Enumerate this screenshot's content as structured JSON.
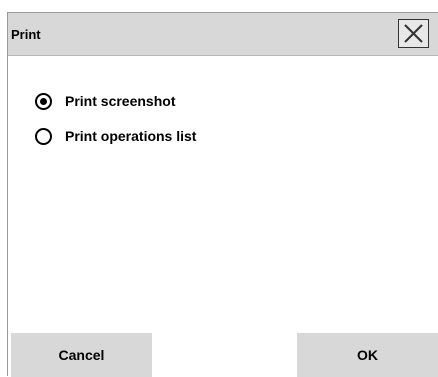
{
  "dialog": {
    "title": "Print",
    "close_icon": "close-x-icon"
  },
  "options": [
    {
      "label": "Print screenshot",
      "selected": true
    },
    {
      "label": "Print operations list",
      "selected": false
    }
  ],
  "buttons": {
    "cancel_label": "Cancel",
    "ok_label": "OK"
  }
}
